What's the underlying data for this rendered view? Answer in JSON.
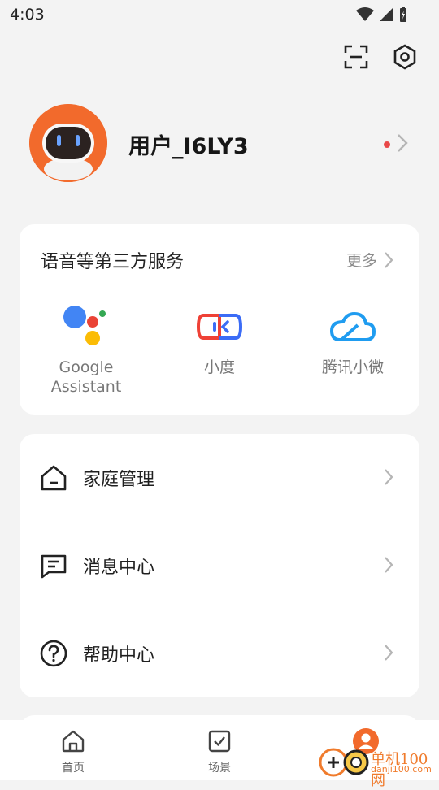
{
  "status_bar": {
    "time": "4:03"
  },
  "profile": {
    "username": "用户_I6LY3"
  },
  "services": {
    "title": "语音等第三方服务",
    "more_label": "更多",
    "items": [
      {
        "label": "Google\nAssistant",
        "icon": "google-assistant-icon"
      },
      {
        "label": "小度",
        "icon": "xiaodu-icon"
      },
      {
        "label": "腾讯小微",
        "icon": "tencent-xiaowei-cloud-icon"
      }
    ]
  },
  "menu": {
    "items": [
      {
        "label": "家庭管理",
        "icon": "home-icon"
      },
      {
        "label": "消息中心",
        "icon": "message-icon"
      },
      {
        "label": "帮助中心",
        "icon": "help-icon"
      }
    ]
  },
  "tabbar": {
    "items": [
      {
        "label": "首页",
        "icon": "home-icon"
      },
      {
        "label": "场景",
        "icon": "checkbox-icon"
      }
    ]
  },
  "watermark": {
    "text": "单机100网",
    "url": "danji100.com"
  },
  "colors": {
    "accent": "#f26a2c",
    "dot": "#e94848",
    "card": "#ffffff",
    "background": "#f3f3f3"
  }
}
